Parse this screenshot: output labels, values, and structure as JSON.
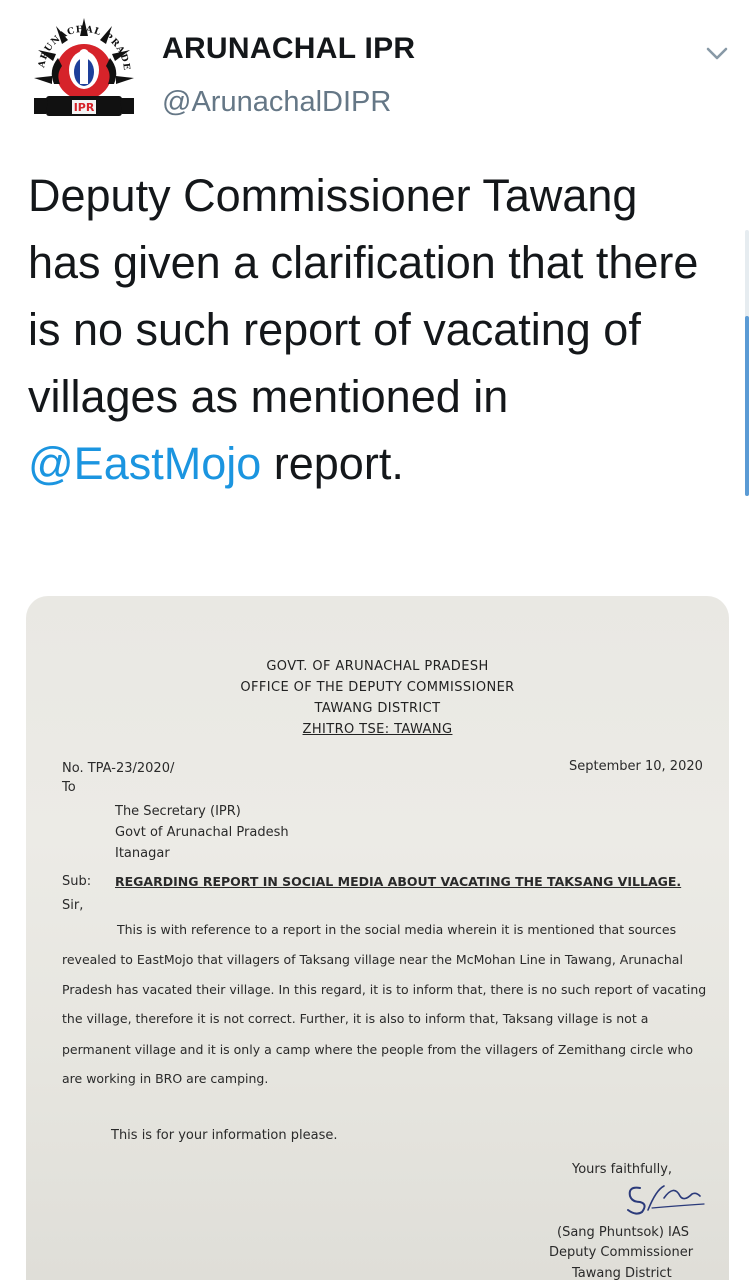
{
  "tweet": {
    "author_name": "ARUNACHAL IPR",
    "author_handle": "@ArunachalDIPR",
    "avatar_text": {
      "arc": "ARUNACHAL PRADESH",
      "banner": "IPR"
    },
    "text_before_mention": "Deputy Commissioner Tawang has given a clarification that there is no such report of vacating of villages as mentioned in ",
    "mention": "@EastMojo",
    "text_after_mention": " report."
  },
  "letter": {
    "header_lines": [
      "GOVT. OF ARUNACHAL PRADESH",
      "OFFICE OF THE DEPUTY COMMISSIONER",
      "TAWANG DISTRICT",
      "ZHITRO TSE: TAWANG"
    ],
    "ref_no": "No. TPA-23/2020/",
    "date": "September 10, 2020",
    "to_label": "To",
    "recipient": [
      "The Secretary (IPR)",
      "Govt of Arunachal Pradesh",
      "Itanagar"
    ],
    "sub_label": "Sub:",
    "subject": "REGARDING REPORT IN SOCIAL MEDIA ABOUT VACATING THE TAKSANG VILLAGE.",
    "salutation": "Sir,",
    "body_lines": [
      "This is with reference to a report in the social media wherein  it is mentioned that sources",
      "revealed to EastMojo that villagers of Taksang village near the McMohan Line in Tawang, Arunachal",
      "Pradesh has vacated their village.  In this regard, it is to inform that, there is no such report of vacating",
      "the village, therefore it is not correct.  Further, it is also to inform that, Taksang village is not a",
      "permanent village and it is only a camp where the people from the villagers of  Zemithang circle who",
      "are working in BRO are camping."
    ],
    "closing_note": "This is for your information please.",
    "sign_off": "Yours faithfully,",
    "signature_initials": "S",
    "signatory_name": "(Sang Phuntsok) IAS",
    "signatory_title": "Deputy Commissioner",
    "signatory_district": "Tawang District"
  },
  "colors": {
    "mention": "#1b95e0",
    "handle": "#657786",
    "scroll_thumb": "#5b9bd5"
  }
}
